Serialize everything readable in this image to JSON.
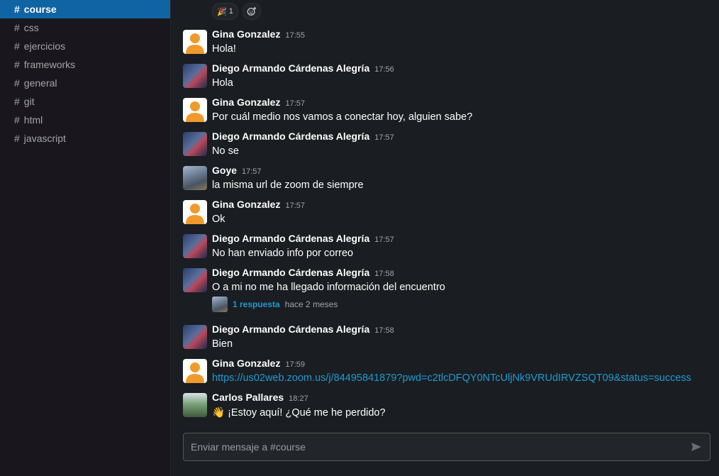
{
  "sidebar": {
    "channels": [
      {
        "label": "course",
        "active": true
      },
      {
        "label": "css"
      },
      {
        "label": "ejercicios"
      },
      {
        "label": "frameworks"
      },
      {
        "label": "general"
      },
      {
        "label": "git"
      },
      {
        "label": "html"
      },
      {
        "label": "javascript"
      }
    ],
    "hash": "#"
  },
  "reactions": {
    "party_count": "1",
    "party_icon": "party-popper-icon",
    "add_icon": "add-reaction-icon"
  },
  "messages": [
    {
      "author": "Gina Gonzalez",
      "time": "17:55",
      "text": "Hola!"
    },
    {
      "author": "Diego Armando Cárdenas Alegría",
      "time": "17:56",
      "text": "Hola"
    },
    {
      "author": "Gina Gonzalez",
      "time": "17:57",
      "text": "Por cuál medio nos vamos a conectar hoy, alguien sabe?"
    },
    {
      "author": "Diego Armando Cárdenas Alegría",
      "time": "17:57",
      "text": "No se"
    },
    {
      "author": "Goye",
      "time": "17:57",
      "text": "la misma url de zoom de siempre"
    },
    {
      "author": "Gina Gonzalez",
      "time": "17:57",
      "text": "Ok"
    },
    {
      "author": "Diego Armando Cárdenas Alegría",
      "time": "17:57",
      "text": "No han enviado info por correo"
    },
    {
      "author": "Diego Armando Cárdenas Alegría",
      "time": "17:58",
      "text": "O a mi no me ha llegado información del encuentro",
      "thread": {
        "count": "1 respuesta",
        "time": "hace 2 meses"
      }
    },
    {
      "author": "Diego Armando Cárdenas Alegría",
      "time": "17:58",
      "text": "Bien"
    },
    {
      "author": "Gina Gonzalez",
      "time": "17:59",
      "text": "https://us02web.zoom.us/j/84495841879?pwd=c2tlcDFQY0NTcUljNk9VRUdIRVZSQT09&status=success"
    },
    {
      "author": "Carlos Pallares",
      "time": "18:27",
      "emoji": "👋",
      "text": "¡Estoy aquí! ¿Qué me he perdido?"
    }
  ],
  "composer": {
    "placeholder": "Enviar mensaje a #course",
    "send_icon": "send-icon"
  },
  "colors": {
    "accent": "#1164a3",
    "link": "#1d9bd1",
    "background": "#1a1d21",
    "sidebar": "#19171d"
  }
}
